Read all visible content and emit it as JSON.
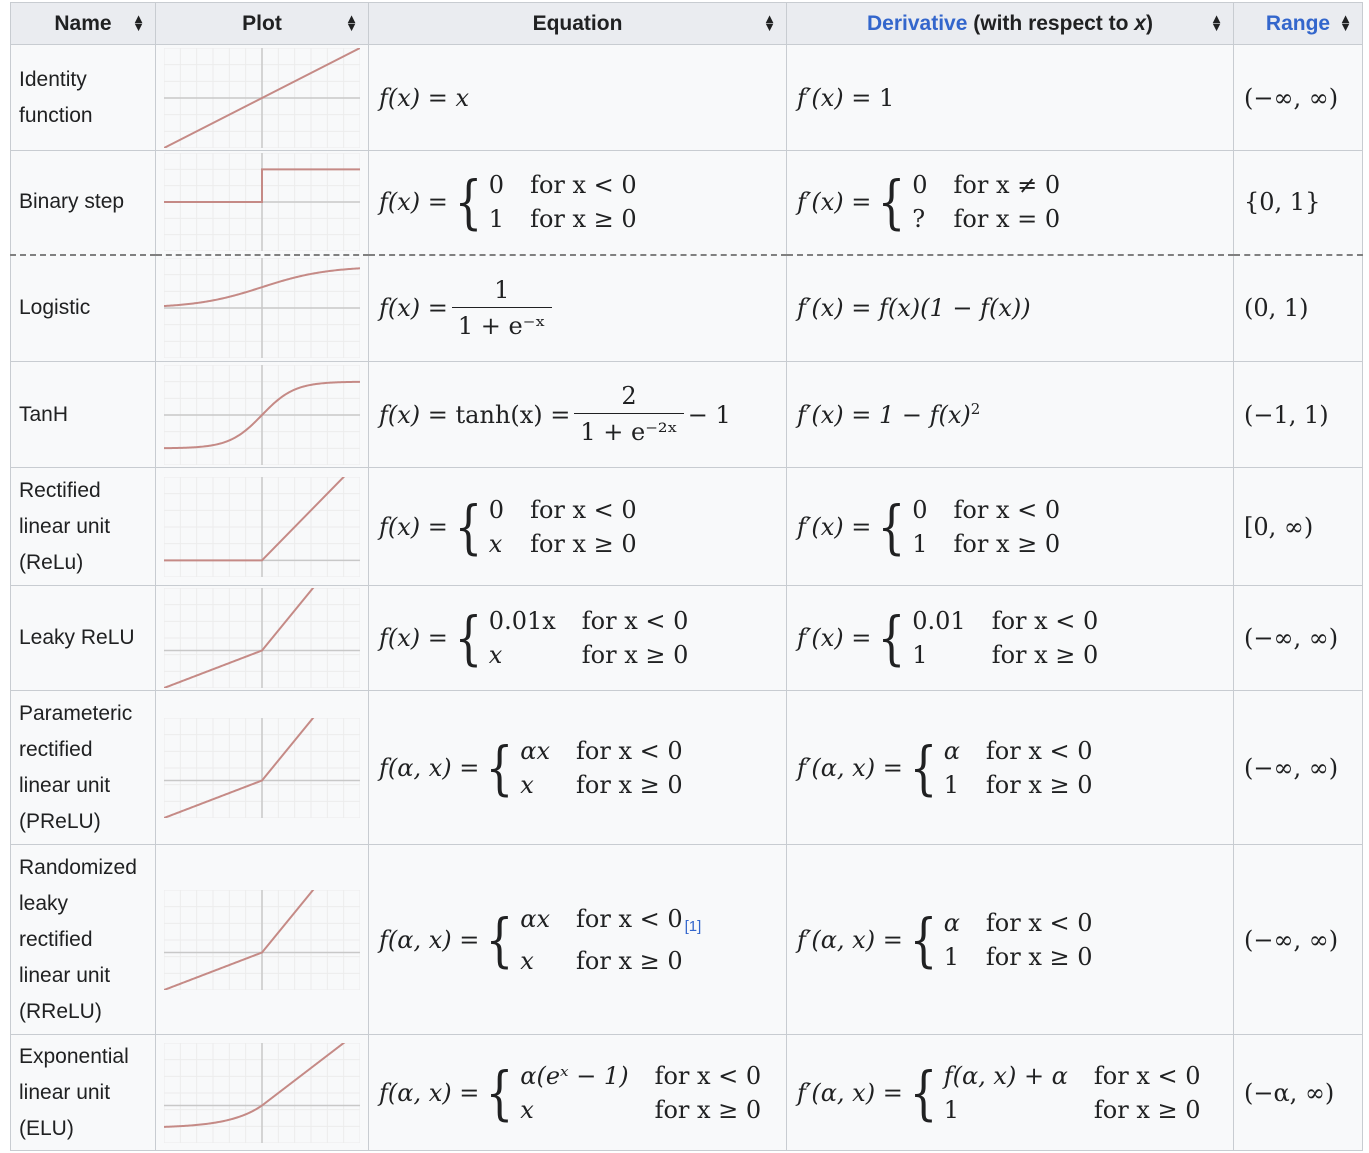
{
  "headers": {
    "name": "Name",
    "plot": "Plot",
    "equation": "Equation",
    "derivative_link": "Derivative",
    "derivative_rest": "(with respect to",
    "derivative_var": "x",
    "derivative_close": ")",
    "range": "Range",
    "sort_up": "▲",
    "sort_down": "▼"
  },
  "rows": [
    {
      "name": "Identity function",
      "range": "(−∞, ∞)"
    },
    {
      "name": "Binary step",
      "range": "{0, 1}"
    },
    {
      "name": "Logistic",
      "range": "(0, 1)"
    },
    {
      "name": "TanH",
      "range": "(−1, 1)"
    },
    {
      "name": "Rectified linear unit (ReLu)",
      "range": "[0, ∞)"
    },
    {
      "name": "Leaky ReLU",
      "range": "(−∞, ∞)"
    },
    {
      "name": "Parameteric rectified linear unit (PReLU)",
      "range": "(−∞, ∞)"
    },
    {
      "name": "Randomized leaky rectified linear unit (RReLU)",
      "range": "(−∞, ∞)"
    },
    {
      "name": "Exponential linear unit (ELU)",
      "range": "(−α, ∞)"
    }
  ],
  "eq": {
    "fx": "f(x) =",
    "fax": "f(α, x) =",
    "identity": "x",
    "step_c1": "0",
    "step_d1": "for x < 0",
    "step_c2": "1",
    "step_d2": "for x ≥ 0",
    "logistic_num": "1",
    "logistic_den": "1 + e⁻ˣ",
    "tanh_mid": "tanh(x) =",
    "tanh_num": "2",
    "tanh_den": "1 + e⁻²ˣ",
    "tanh_tail": "− 1",
    "relu_c1": "0",
    "relu_d1": "for x < 0",
    "relu_c2": "x",
    "relu_d2": "for x ≥ 0",
    "leaky_c1": "0.01x",
    "leaky_d1": "for x < 0",
    "leaky_c2": "x",
    "leaky_d2": "for x ≥ 0",
    "prelu_c1": "αx",
    "prelu_d1": "for x < 0",
    "prelu_c2": "x",
    "prelu_d2": "for x ≥ 0",
    "rrelu_c1": "αx",
    "rrelu_d1": "for x < 0",
    "rrelu_ref": "[1]",
    "rrelu_c2": "x",
    "rrelu_d2": "for x ≥ 0",
    "elu_c1": "α(eˣ − 1)",
    "elu_d1": "for x < 0",
    "elu_c2": "x",
    "elu_d2": "for x ≥ 0"
  },
  "der": {
    "fpx": "f′(x) =",
    "fpax": "f′(α, x) =",
    "identity": "1",
    "step_c1": "0",
    "step_d1": "for x ≠ 0",
    "step_c2": "?",
    "step_d2": "for x = 0",
    "logistic": "f(x)(1 − f(x))",
    "tanh": "1 − f(x)",
    "tanh_sup": "2",
    "relu_c1": "0",
    "relu_d1": "for x < 0",
    "relu_c2": "1",
    "relu_d2": "for x ≥ 0",
    "leaky_c1": "0.01",
    "leaky_d1": "for x < 0",
    "leaky_c2": "1",
    "leaky_d2": "for x ≥ 0",
    "prelu_c1": "α",
    "prelu_d1": "for x < 0",
    "prelu_c2": "1",
    "prelu_d2": "for x ≥ 0",
    "rrelu_c1": "α",
    "rrelu_d1": "for x < 0",
    "rrelu_c2": "1",
    "rrelu_d2": "for x ≥ 0",
    "elu_c1": "f(α, x) + α",
    "elu_d1": "for x < 0",
    "elu_c2": "1",
    "elu_d2": "for x ≥ 0"
  },
  "colors": {
    "curve": "#c58a86",
    "grid": "#ececec",
    "axis": "#c8c8c8",
    "link": "#3366cc"
  },
  "plots": [
    "identity",
    "binary-step",
    "logistic",
    "tanh",
    "relu",
    "leaky-relu",
    "prelu",
    "rrelu",
    "elu"
  ]
}
